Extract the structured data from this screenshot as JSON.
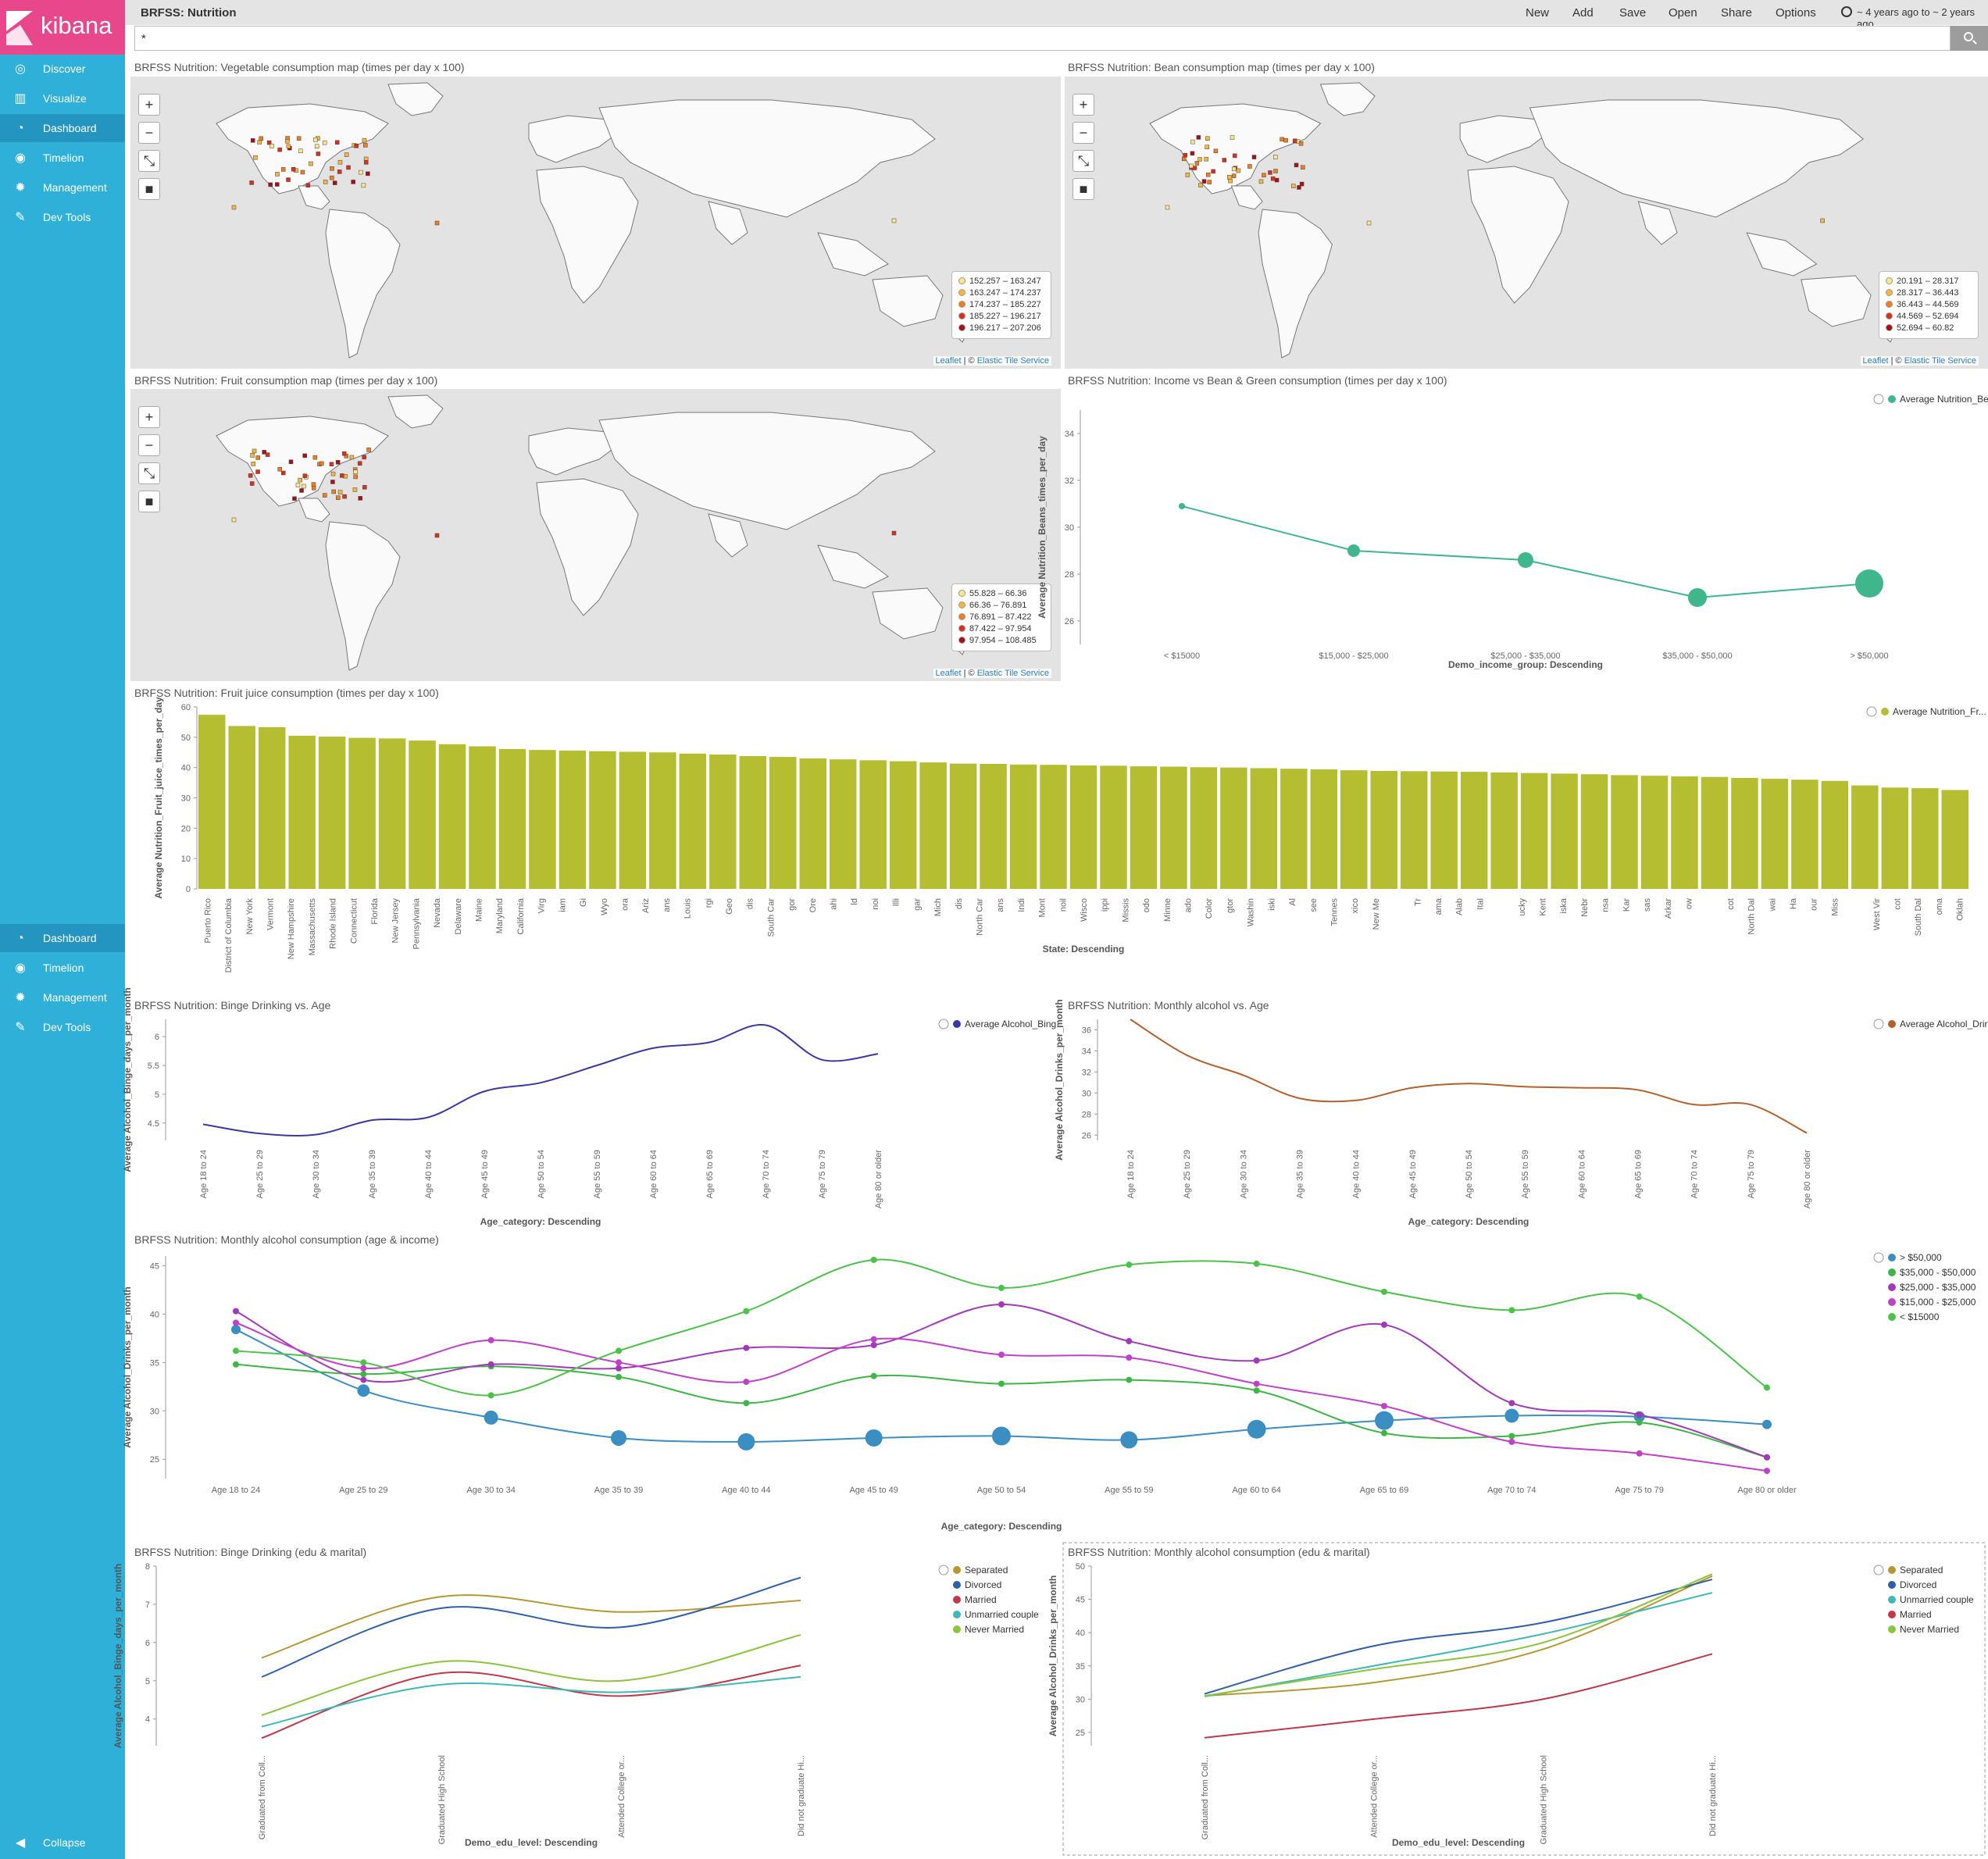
{
  "app": {
    "brand": "kibana",
    "dashboard_title": "BRFSS: Nutrition",
    "colors": {
      "sidebar": "#2fb0d9",
      "logo": "#e8488b"
    }
  },
  "nav": {
    "top": [
      {
        "label": "Discover",
        "icon": "compass-icon"
      },
      {
        "label": "Visualize",
        "icon": "bar-chart-icon"
      },
      {
        "label": "Dashboard",
        "icon": "dashboard-icon"
      },
      {
        "label": "Timelion",
        "icon": "timelion-icon"
      },
      {
        "label": "Management",
        "icon": "gear-icon"
      },
      {
        "label": "Dev Tools",
        "icon": "wrench-icon"
      }
    ],
    "repeat": [
      {
        "label": "Dashboard",
        "icon": "dashboard-icon"
      },
      {
        "label": "Timelion",
        "icon": "timelion-icon"
      },
      {
        "label": "Management",
        "icon": "gear-icon"
      },
      {
        "label": "Dev Tools",
        "icon": "wrench-icon"
      }
    ],
    "collapse": "Collapse"
  },
  "topbar": {
    "new": "New",
    "add": "Add",
    "save": "Save",
    "open": "Open",
    "share": "Share",
    "options": "Options",
    "time_range": "~ 4 years ago to ~ 2 years ago"
  },
  "search": {
    "query": "*"
  },
  "maps": [
    {
      "title": "BRFSS Nutrition: Vegetable consumption map (times per day x 100)",
      "legend": [
        "152.257 – 163.247",
        "163.247 – 174.237",
        "174.237 – 185.227",
        "185.227 – 196.217",
        "196.217 – 207.206"
      ]
    },
    {
      "title": "BRFSS Nutrition: Bean consumption map (times per day x 100)",
      "legend": [
        "20.191 – 28.317",
        "28.317 – 36.443",
        "36.443 – 44.569",
        "44.569 – 52.694",
        "52.694 – 60.82"
      ]
    },
    {
      "title": "BRFSS Nutrition: Fruit consumption map (times per day x 100)",
      "legend": [
        "55.828 – 66.36",
        "66.36 – 76.891",
        "76.891 – 87.422",
        "87.422 – 97.954",
        "97.954 – 108.485"
      ]
    }
  ],
  "map_attribution": {
    "leaflet": "Leaflet",
    "sep": " | © ",
    "service": "Elastic Tile Service"
  },
  "map_legend_colors": [
    "#fde68a",
    "#f6b73c",
    "#ef7d22",
    "#d7301f",
    "#a50f15"
  ],
  "charts": {
    "income": {
      "title": "BRFSS Nutrition: Income vs Bean & Green consumption (times per day x 100)"
    },
    "juice": {
      "title": "BRFSS Nutrition: Fruit juice consumption (times per day x 100)"
    },
    "binge_age": {
      "title": "BRFSS Nutrition: Binge Drinking vs. Age"
    },
    "monthly_age": {
      "title": "BRFSS Nutrition: Monthly alcohol vs. Age"
    },
    "age_income": {
      "title": "BRFSS Nutrition: Monthly alcohol consumption (age & income)"
    },
    "binge_edu": {
      "title": "BRFSS Nutrition: Binge Drinking (edu & marital)"
    },
    "monthly_edu": {
      "title": "BRFSS Nutrition: Monthly alcohol consumption (edu & marital)"
    }
  },
  "chart_data": [
    {
      "id": "income",
      "type": "line",
      "ylabel": "Average Nutrition_Beans_times_per_day",
      "xlabel": "Demo_income_group: Descending",
      "categories": [
        "< $15000",
        "$15,000 - $25,000",
        "$25,000 - $35,000",
        "$35,000 - $50,000",
        "> $50,000"
      ],
      "series": [
        {
          "name": "Average Nutrition_Be...",
          "color": "#3fb68b",
          "values": [
            30.9,
            29.0,
            28.6,
            27.0,
            27.6
          ]
        }
      ],
      "ylim": [
        25,
        35
      ],
      "yticks": [
        26,
        28,
        30,
        32,
        34
      ]
    },
    {
      "id": "juice",
      "type": "bar",
      "ylabel": "Average Nutrition_Fruit_juice_times_per_day",
      "xlabel": "State: Descending",
      "series": [
        {
          "name": "Average Nutrition_Fr...",
          "color": "#b5be31"
        }
      ],
      "categories": [
        "Puerto Rico",
        "District of Columbia",
        "New York",
        "Vermont",
        "New Hampshire",
        "Massachusetts",
        "Rhode Island",
        "Connecticut",
        "Florida",
        "New Jersey",
        "Pennsylvania",
        "Nevada",
        "Delaware",
        "Maine",
        "Maryland",
        "California",
        "Virg",
        "iam",
        "Gi",
        "Wyo",
        "ora",
        "Ariz",
        "ans",
        "Louis",
        "rgi",
        "Geo",
        "dis",
        "South Car",
        "gor",
        "Ore",
        "ahi",
        "ld",
        "noi",
        "Illi",
        "gar",
        "Mich",
        "dis",
        "North Car",
        "ans",
        "Indi",
        "Mont",
        "noil",
        "Wisco",
        "ippi",
        "Missis",
        "odo",
        "Minne",
        "ado",
        "Color",
        "gtor",
        "Washin",
        "iski",
        "Al",
        "see",
        "Tennes",
        "xico",
        "New Me",
        "",
        "Tr",
        "ama",
        "Alab",
        "Ital",
        "",
        "ucky",
        "Kent",
        "iska",
        "Nebr",
        "nsa",
        "Kar",
        "sas",
        "Arkar",
        "ow",
        "",
        "cot",
        "North Dal",
        "wai",
        "Ha",
        "our",
        "Miss",
        "",
        "West Vir",
        "cot",
        "South Dal",
        "oma",
        "Oklah"
      ],
      "values": [
        57.4,
        53.7,
        53.3,
        50.5,
        50.2,
        49.8,
        49.6,
        48.9,
        47.7,
        47.0,
        46.1,
        45.8,
        45.6,
        45.4,
        45.2,
        45.0,
        44.6,
        44.3,
        43.8,
        43.5,
        43.0,
        42.7,
        42.4,
        42.1,
        41.7,
        41.3,
        41.2,
        41.0,
        40.9,
        40.7,
        40.6,
        40.4,
        40.3,
        40.1,
        40.0,
        39.8,
        39.6,
        39.4,
        39.1,
        38.9,
        38.8,
        38.7,
        38.6,
        38.4,
        38.2,
        38.0,
        37.8,
        37.5,
        37.3,
        37.1,
        36.9,
        36.6,
        36.3,
        36.0,
        35.6,
        34.1,
        33.4,
        33.2,
        32.6
      ],
      "ylim": [
        0,
        60
      ],
      "yticks": [
        0,
        10,
        20,
        30,
        40,
        50,
        60
      ]
    },
    {
      "id": "binge_age",
      "type": "line",
      "ylabel": "Average Alcohol_Binge_days_per_month",
      "xlabel": "Age_category: Descending",
      "categories": [
        "Age 18 to 24",
        "Age 25 to 29",
        "Age 30 to 34",
        "Age 35 to 39",
        "Age 40 to 44",
        "Age 45 to 49",
        "Age 50 to 54",
        "Age 55 to 59",
        "Age 60 to 64",
        "Age 65 to 69",
        "Age 70 to 74",
        "Age 75 to 79",
        "Age 80 or older"
      ],
      "series": [
        {
          "name": "Average Alcohol_Bing...",
          "color": "#3b37a3",
          "values": [
            4.48,
            4.32,
            4.3,
            4.55,
            4.6,
            5.05,
            5.2,
            5.5,
            5.8,
            5.9,
            6.2,
            5.6,
            5.7
          ]
        }
      ],
      "ylim": [
        4.2,
        6.3
      ],
      "yticks": [
        4.5,
        5,
        5.5,
        6
      ]
    },
    {
      "id": "monthly_age",
      "type": "line",
      "ylabel": "Average Alcohol_Drinks_per_month",
      "xlabel": "Age_category: Descending",
      "categories": [
        "Age 18 to 24",
        "Age 25 to 29",
        "Age 30 to 34",
        "Age 35 to 39",
        "Age 40 to 44",
        "Age 45 to 49",
        "Age 50 to 54",
        "Age 55 to 59",
        "Age 60 to 64",
        "Age 65 to 69",
        "Age 70 to 74",
        "Age 75 to 79",
        "Age 80 or older"
      ],
      "series": [
        {
          "name": "Average Alcohol_Drin...",
          "color": "#b4602d",
          "values": [
            37.0,
            33.6,
            31.7,
            29.5,
            29.3,
            30.5,
            30.9,
            30.6,
            30.5,
            30.3,
            28.9,
            28.9,
            26.2
          ]
        }
      ],
      "ylim": [
        25.5,
        37
      ],
      "yticks": [
        26,
        28,
        30,
        32,
        34,
        36
      ]
    },
    {
      "id": "age_income",
      "type": "line",
      "ylabel": "Average Alcohol_Drinks_per_month",
      "xlabel": "Age_category: Descending",
      "categories": [
        "Age 18 to 24",
        "Age 25 to 29",
        "Age 30 to 34",
        "Age 35 to 39",
        "Age 40 to 44",
        "Age 45 to 49",
        "Age 50 to 54",
        "Age 55 to 59",
        "Age 60 to 64",
        "Age 65 to 69",
        "Age 70 to 74",
        "Age 75 to 79",
        "Age 80 or older"
      ],
      "ylim": [
        23,
        46
      ],
      "yticks": [
        25,
        30,
        35,
        40,
        45
      ],
      "series": [
        {
          "name": "> $50,000",
          "color": "#3b8ec2",
          "values": [
            38.4,
            32.1,
            29.3,
            27.2,
            26.8,
            27.2,
            27.4,
            27.0,
            28.1,
            29.0,
            29.5,
            29.4,
            28.6
          ]
        },
        {
          "name": "$35,000 - $50,000",
          "color": "#3db646",
          "values": [
            34.8,
            33.8,
            34.6,
            33.5,
            30.8,
            33.6,
            32.8,
            33.2,
            32.1,
            27.7,
            27.4,
            28.8,
            25.2
          ]
        },
        {
          "name": "$25,000 - $35,000",
          "color": "#a03ab8",
          "values": [
            40.3,
            33.2,
            34.8,
            34.4,
            36.5,
            36.8,
            41.0,
            37.2,
            35.2,
            38.9,
            30.8,
            29.6,
            25.2
          ]
        },
        {
          "name": "$15,000 - $25,000",
          "color": "#c040c8",
          "values": [
            39.1,
            34.4,
            37.3,
            35.0,
            33.0,
            37.4,
            35.8,
            35.5,
            32.8,
            30.5,
            26.8,
            25.6,
            23.8
          ]
        },
        {
          "name": "< $15000",
          "color": "#4cc24a",
          "values": [
            36.2,
            35.0,
            31.6,
            36.2,
            40.3,
            45.6,
            42.7,
            45.1,
            45.2,
            42.3,
            40.4,
            41.8,
            32.4
          ]
        }
      ]
    },
    {
      "id": "binge_edu",
      "type": "line",
      "ylabel": "Average Alcohol_Binge_days_per_month",
      "xlabel": "Demo_edu_level: Descending",
      "categories": [
        "Graduated from Coll...",
        "Graduated High School",
        "Attended College or...",
        "Did not graduate Hi..."
      ],
      "ylim": [
        3.3,
        8
      ],
      "yticks": [
        4,
        5,
        6,
        7,
        8
      ],
      "series": [
        {
          "name": "Separated",
          "color": "#b59734",
          "values": [
            5.6,
            7.2,
            6.8,
            7.1
          ]
        },
        {
          "name": "Divorced",
          "color": "#2f5eaa",
          "values": [
            5.1,
            6.9,
            6.4,
            7.7
          ]
        },
        {
          "name": "Married",
          "color": "#c0384b",
          "values": [
            3.5,
            5.2,
            4.6,
            5.4
          ]
        },
        {
          "name": "Unmarried couple",
          "color": "#3fb8b8",
          "values": [
            3.8,
            4.9,
            4.7,
            5.1
          ]
        },
        {
          "name": "Never Married",
          "color": "#8cc43c",
          "values": [
            4.1,
            5.5,
            5.0,
            6.2
          ]
        }
      ]
    },
    {
      "id": "monthly_edu",
      "type": "line",
      "ylabel": "Average Alcohol_Drinks_per_month",
      "xlabel": "Demo_edu_level: Descending",
      "categories": [
        "Graduated from Coll...",
        "Attended College or...",
        "Graduated High School",
        "Did not graduate Hi..."
      ],
      "ylim": [
        23,
        50
      ],
      "yticks": [
        25,
        30,
        35,
        40,
        45,
        50
      ],
      "series": [
        {
          "name": "Separated",
          "color": "#b59734",
          "values": [
            30.5,
            32.5,
            37.5,
            48.5
          ]
        },
        {
          "name": "Divorced",
          "color": "#2f5eaa",
          "values": [
            30.8,
            38.0,
            41.5,
            48.0
          ]
        },
        {
          "name": "Unmarried couple",
          "color": "#3fb8b8",
          "values": [
            30.4,
            35.0,
            39.8,
            46.0
          ]
        },
        {
          "name": "Married",
          "color": "#c0384b",
          "values": [
            24.2,
            27.0,
            30.0,
            36.8
          ]
        },
        {
          "name": "Never Married",
          "color": "#8cc43c",
          "values": [
            30.5,
            34.5,
            38.5,
            48.8
          ]
        }
      ]
    }
  ]
}
